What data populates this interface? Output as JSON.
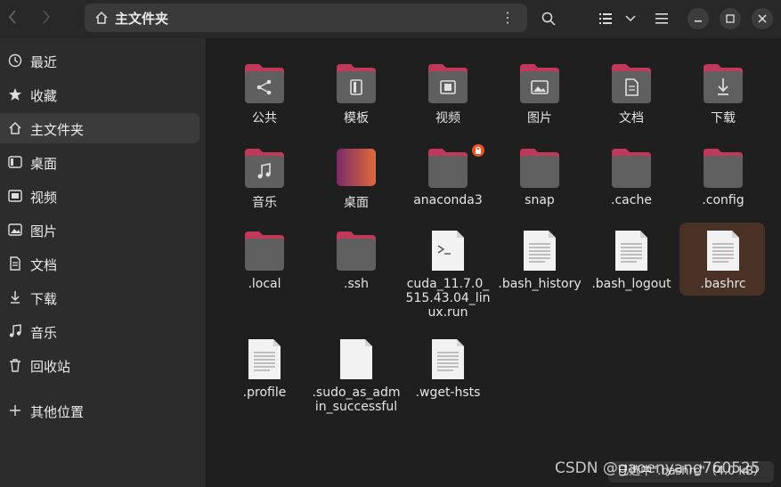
{
  "header": {
    "title": "主文件夹",
    "back_icon": "back-icon",
    "forward_icon": "forward-icon",
    "menu_icon": "kebab-menu-icon"
  },
  "sidebar": {
    "items": [
      {
        "label": "最近",
        "icon": "clock-icon"
      },
      {
        "label": "收藏",
        "icon": "star-icon"
      },
      {
        "label": "主文件夹",
        "icon": "home-icon",
        "active": true
      },
      {
        "label": "桌面",
        "icon": "desktop-icon"
      },
      {
        "label": "视频",
        "icon": "video-icon"
      },
      {
        "label": "图片",
        "icon": "image-icon"
      },
      {
        "label": "文档",
        "icon": "document-icon"
      },
      {
        "label": "下载",
        "icon": "download-icon"
      },
      {
        "label": "音乐",
        "icon": "music-icon"
      },
      {
        "label": "回收站",
        "icon": "trash-icon"
      },
      {
        "label": "其他位置",
        "icon": "plus-icon"
      }
    ]
  },
  "files": [
    {
      "name": "公共",
      "kind": "folder",
      "emblem": "share"
    },
    {
      "name": "模板",
      "kind": "folder",
      "emblem": "template"
    },
    {
      "name": "视频",
      "kind": "folder",
      "emblem": "film"
    },
    {
      "name": "图片",
      "kind": "folder",
      "emblem": "image"
    },
    {
      "name": "文档",
      "kind": "folder",
      "emblem": "doc"
    },
    {
      "name": "下载",
      "kind": "folder",
      "emblem": "download"
    },
    {
      "name": "音乐",
      "kind": "folder",
      "emblem": "music"
    },
    {
      "name": "桌面",
      "kind": "desktop"
    },
    {
      "name": "anaconda3",
      "kind": "folder",
      "locked": true
    },
    {
      "name": "snap",
      "kind": "folder"
    },
    {
      "name": ".cache",
      "kind": "folder"
    },
    {
      "name": ".config",
      "kind": "folder"
    },
    {
      "name": ".local",
      "kind": "folder"
    },
    {
      "name": ".ssh",
      "kind": "folder"
    },
    {
      "name": "cuda_11.7.0_515.43.04_linux.run",
      "kind": "script"
    },
    {
      "name": ".bash_history",
      "kind": "text"
    },
    {
      "name": ".bash_logout",
      "kind": "text"
    },
    {
      "name": ".bashrc",
      "kind": "text",
      "selected": true
    },
    {
      "name": ".profile",
      "kind": "text"
    },
    {
      "name": ".sudo_as_admin_successful",
      "kind": "blank"
    },
    {
      "name": ".wget-hsts",
      "kind": "text"
    }
  ],
  "status": "已选中\".bashrc\"（4.0 kB）",
  "watermark": "CSDN @gaoenyang760525",
  "colors": {
    "folder_tab": "#c0395a",
    "folder_body": "#5f5f5f",
    "selection": "#4a3126",
    "accent_lock": "#e95420"
  }
}
